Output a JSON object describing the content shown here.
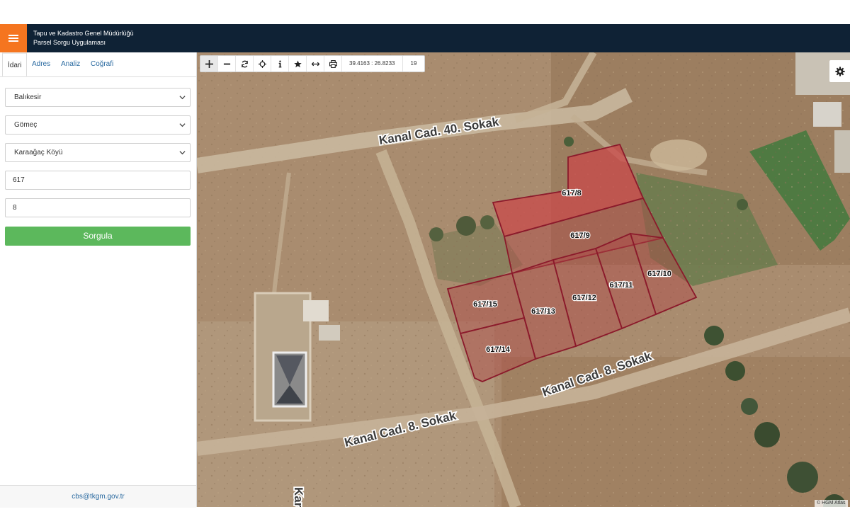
{
  "header": {
    "title_line1": "Tapu ve Kadastro Genel Müdürlüğü",
    "title_line2": "Parsel Sorgu Uygulaması",
    "menu_icon": "hamburger-icon",
    "accent_color": "#f5751f",
    "bar_color": "#0f2235"
  },
  "sidebar": {
    "tabs": [
      {
        "label": "İdari",
        "active": true
      },
      {
        "label": "Adres"
      },
      {
        "label": "Analiz"
      },
      {
        "label": "Coğrafi"
      }
    ],
    "province": "Balıkesir",
    "district": "Gömeç",
    "neighborhood": "Karaağaç Köyü",
    "block": "617",
    "parcel": "8",
    "query_button": "Sorgula",
    "query_button_color": "#5cb85c",
    "footer_email": "cbs@tkgm.gov.tr"
  },
  "toolbar": {
    "icons": [
      "pan-icon",
      "zoom-out-icon",
      "refresh-icon",
      "locate-icon",
      "info-icon",
      "favorite-icon",
      "measure-icon",
      "print-icon"
    ],
    "coordinates": "39.4163 : 26.8233",
    "zoom_level": "19"
  },
  "map": {
    "streets": [
      "Kanal Cad. 40. Sokak",
      "Kanal Cad. 8. Sokak",
      "Kanal Cad. 8. Sokak",
      "Kara"
    ],
    "parcels": [
      "617/8",
      "617/9",
      "617/10",
      "617/11",
      "617/12",
      "617/13",
      "617/14",
      "617/15"
    ],
    "selected_parcel": "617/8",
    "parcel_outline_color": "#8b1a2b",
    "selected_fill_color": "#c94a4a",
    "attribution": "© HGM Atlas",
    "settings_icon": "gear-icon"
  }
}
